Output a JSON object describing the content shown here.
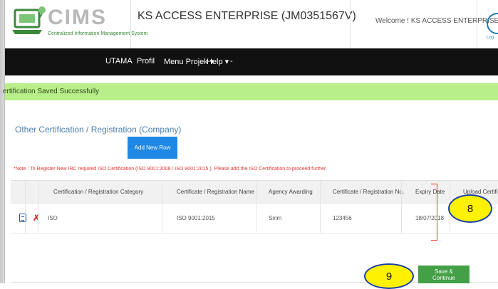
{
  "header": {
    "logo_text": "CIMS",
    "logo_subtitle": "Centralized Information Management System",
    "company": "KS ACCESS ENTERPRISE (JM0351567V)",
    "welcome": "Welcome ! KS ACCESS ENTERPRISE ▾",
    "logout_label": "Log"
  },
  "nav": {
    "items": [
      "UTAMA",
      "Profil",
      "Menu Projek ▾",
      "Help ▾",
      "-"
    ]
  },
  "alert": {
    "text": "ertification Saved Successfully"
  },
  "section": {
    "title": "Other Certification / Registration (Company)",
    "add_row_label": "Add New Row",
    "note": "*Note : To Register New IRC required ISO Certification (ISO 9001:2008 / ISO 9001:2015 ). Please add the ISO Certification to proceed further."
  },
  "table": {
    "columns": [
      "Certification / Registration Category",
      "Certificate / Registration Name",
      "Agency Awarding",
      "Certificate / Registration No.",
      "Expiry Date",
      "Upload Certificate"
    ],
    "rows": [
      {
        "category": "ISO",
        "name": "ISO 9001:2015",
        "agency": "Sirim",
        "number": "123456",
        "expiry": "18/07/2018",
        "upload": ""
      }
    ]
  },
  "callouts": {
    "c8": "8",
    "c9": "9"
  },
  "footer": {
    "save_label": "Save & Continue"
  },
  "colors": {
    "nav_bg": "#111111",
    "alert_bg": "#b8ef8a",
    "primary_button": "#1e88e5",
    "success_button": "#43a047",
    "note_text": "#e53935",
    "callout_fill": "#fff200",
    "callout_border": "#1a3fa8"
  },
  "icons": [
    "logo-icon",
    "logout-icon",
    "document-icon",
    "delete-icon"
  ]
}
